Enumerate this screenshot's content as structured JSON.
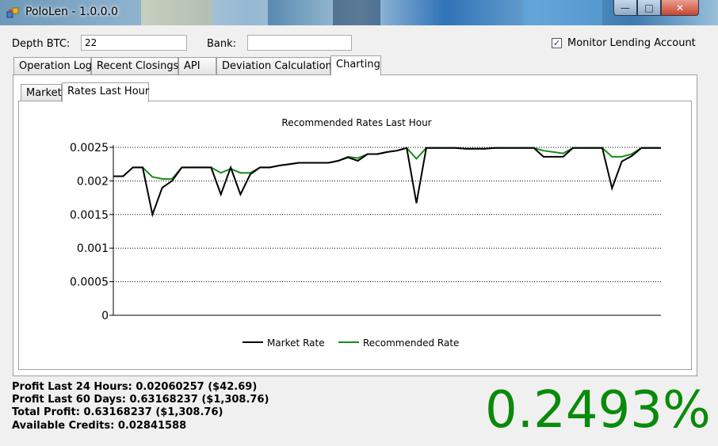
{
  "window": {
    "title": "PoloLen - 1.0.0.0",
    "min_glyph": "—",
    "max_glyph": "□",
    "close_glyph": "✕"
  },
  "header": {
    "depth_label": "Depth BTC:",
    "depth_value": "22",
    "bank_label": "Bank:",
    "bank_value": "",
    "monitor_label": "Monitor Lending Account",
    "monitor_checked": true,
    "check_glyph": "✓"
  },
  "tabs": [
    "Operation Log",
    "Recent Closings",
    "API",
    "Deviation Calculations",
    "Charting"
  ],
  "active_tab": "Charting",
  "subtabs": [
    "Market",
    "Rates Last Hour"
  ],
  "active_subtab": "Rates Last Hour",
  "chart_data": {
    "type": "line",
    "title": "Recommended Rates Last Hour",
    "xlabel": "",
    "ylabel": "",
    "ylim": [
      0,
      0.0025
    ],
    "yticks": [
      "0.0025",
      "0.002",
      "0.0015",
      "0.001",
      "0.0005",
      "0"
    ],
    "grid": true,
    "legend_position": "bottom",
    "series": [
      {
        "name": "Market Rate",
        "color": "#000000",
        "values": [
          0.00207,
          0.00207,
          0.0022,
          0.0022,
          0.0015,
          0.0019,
          0.002,
          0.0022,
          0.0022,
          0.0022,
          0.0022,
          0.0018,
          0.0022,
          0.0018,
          0.0021,
          0.0022,
          0.0022,
          0.00223,
          0.00225,
          0.00227,
          0.00227,
          0.00227,
          0.00227,
          0.0023,
          0.00235,
          0.0023,
          0.0024,
          0.0024,
          0.00243,
          0.00245,
          0.00249,
          0.00167,
          0.00249,
          0.00249,
          0.00249,
          0.00249,
          0.00248,
          0.00248,
          0.00248,
          0.00249,
          0.00249,
          0.00249,
          0.00249,
          0.00249,
          0.00236,
          0.00236,
          0.00236,
          0.00249,
          0.00249,
          0.00249,
          0.00249,
          0.00189,
          0.00229,
          0.00237,
          0.00249,
          0.00249,
          0.00249
        ]
      },
      {
        "name": "Recommended Rate",
        "color": "#1a8a1a",
        "values": [
          0.00207,
          0.00207,
          0.0022,
          0.0022,
          0.00206,
          0.00203,
          0.00203,
          0.0022,
          0.0022,
          0.0022,
          0.0022,
          0.00212,
          0.00218,
          0.00212,
          0.00212,
          0.0022,
          0.0022,
          0.00223,
          0.00225,
          0.00227,
          0.00227,
          0.00227,
          0.00227,
          0.0023,
          0.00236,
          0.00234,
          0.0024,
          0.0024,
          0.00243,
          0.00245,
          0.00249,
          0.00233,
          0.00249,
          0.00249,
          0.00249,
          0.00249,
          0.00248,
          0.00248,
          0.00248,
          0.00249,
          0.00249,
          0.00249,
          0.00249,
          0.00249,
          0.00245,
          0.00243,
          0.00241,
          0.00249,
          0.00249,
          0.00249,
          0.00249,
          0.00236,
          0.00236,
          0.0024,
          0.00249,
          0.00249,
          0.00249
        ]
      }
    ]
  },
  "stats": {
    "profit_24h": "Profit Last 24 Hours:  0.02060257 ($42.69)",
    "profit_60d": "Profit Last 60 Days: 0.63168237 ($1,308.76)",
    "total_profit": "Total Profit: 0.63168237 ($1,308.76)",
    "available_credits": "Available Credits:  0.02841588"
  },
  "current_rate": "0.2493%",
  "colors": {
    "rate_text": "#0a8a0a",
    "market_line": "#000000",
    "recommended_line": "#1a8a1a"
  }
}
